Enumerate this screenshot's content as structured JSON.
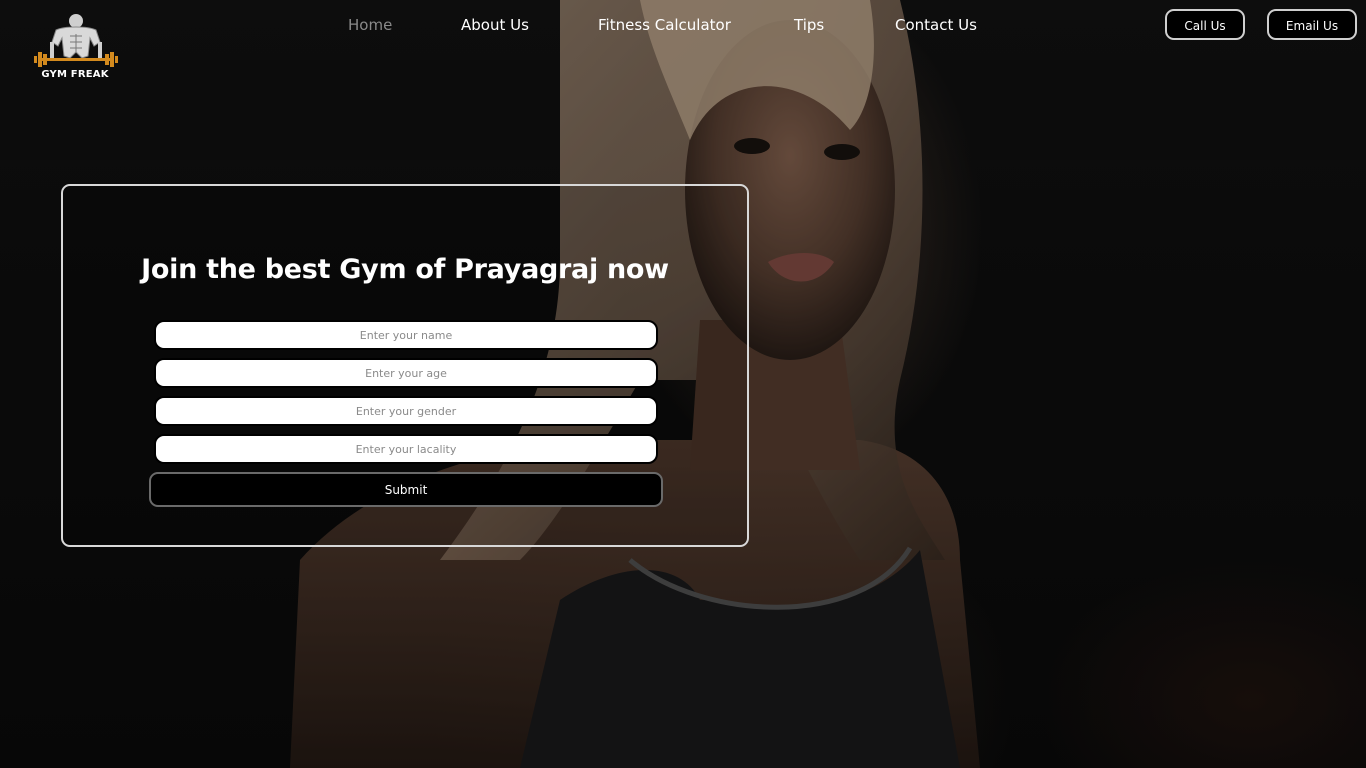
{
  "brand": {
    "name": "GYM FREAK",
    "logo_icon": "bodybuilder-dumbbell-icon",
    "accent_color": "#d38a1e"
  },
  "nav": {
    "items": [
      {
        "label": "Home",
        "active": true
      },
      {
        "label": "About Us",
        "active": false
      },
      {
        "label": "Fitness Calculator",
        "active": false
      },
      {
        "label": "Tips",
        "active": false
      },
      {
        "label": "Contact Us",
        "active": false
      }
    ]
  },
  "header_actions": {
    "call_label": "Call Us",
    "email_label": "Email Us"
  },
  "join_form": {
    "title": "Join the best Gym of Prayagraj now",
    "fields": [
      {
        "placeholder": "Enter your name",
        "value": ""
      },
      {
        "placeholder": "Enter your age",
        "value": ""
      },
      {
        "placeholder": "Enter your gender",
        "value": ""
      },
      {
        "placeholder": "Enter your lacality",
        "value": ""
      }
    ],
    "submit_label": "Submit"
  },
  "colors": {
    "background": "#0d0d0d",
    "text": "#ffffff",
    "nav_active": "#8a8a8a",
    "button_bg": "#000000"
  }
}
